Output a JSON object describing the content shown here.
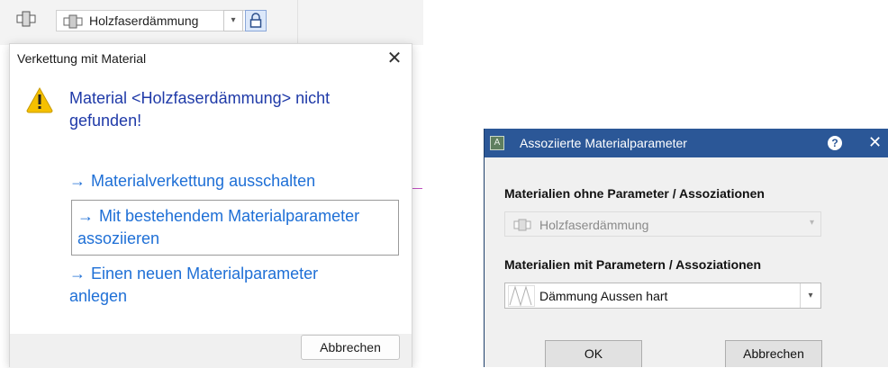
{
  "toolbar": {
    "material_combo_value": "Holzfaserdämmung"
  },
  "dialog_link": {
    "title": "Verkettung mit Material",
    "close_label": "✕",
    "message": "Material <Holzfaserdämmung> nicht gefunden!",
    "arrow": "→",
    "commands": [
      "Materialverkettung ausschalten",
      "Mit bestehendem Materialparameter assoziieren",
      "Einen neuen Materialparameter anlegen"
    ],
    "cancel_label": "Abbrechen",
    "icon": "warning-icon",
    "warning_color": "#f5c000"
  },
  "dialog_assoc": {
    "title": "Assoziierte Materialparameter",
    "help_label": "?",
    "close_label": "✕",
    "section1_label": "Materialien ohne Parameter / Assoziationen",
    "section1_value": "Holzfaserdämmung",
    "section2_label": "Materialien mit Parametern / Assoziationen",
    "section2_value": "Dämmung Aussen hart",
    "ok_label": "OK",
    "cancel_label": "Abbrechen",
    "app_icon_letter": "A",
    "title_bar_color": "#2b5797"
  }
}
